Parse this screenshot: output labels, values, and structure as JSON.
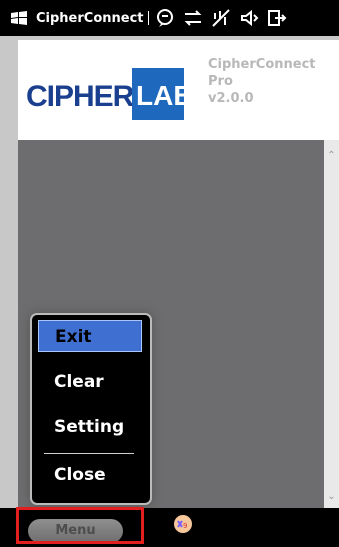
{
  "statusbar": {
    "app_title": "CipherConnect",
    "icons": [
      "windows-flag-icon",
      "message-icon",
      "sync-icon",
      "signal-icon",
      "speaker-icon",
      "exit-icon"
    ]
  },
  "header": {
    "logo_cipher": "CIPHER",
    "logo_lab": "LAB",
    "app_name_line1": "CipherConnect",
    "app_name_line2": "Pro",
    "version": "v2.0.0"
  },
  "popup_menu": {
    "items": [
      "Exit",
      "Clear",
      "Setting",
      "Close"
    ],
    "selected_index": 0
  },
  "bottombar": {
    "menu_label": "Menu"
  },
  "colors": {
    "logo_blue": "#1b3f8f",
    "logo_box": "#1e69bd",
    "selected_item": "#3f6fd0",
    "highlight_red": "#e11f1f"
  }
}
